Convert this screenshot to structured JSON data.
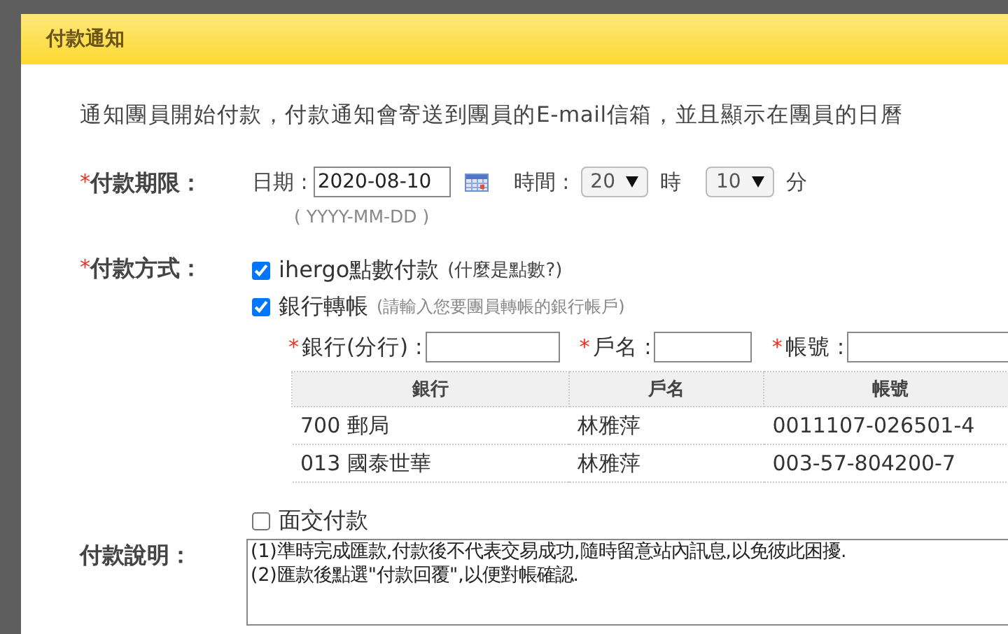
{
  "dialog": {
    "title": "付款通知",
    "description": "通知團員開始付款，付款通知會寄送到團員的E-mail信箱，並且顯示在團員的日曆",
    "deadline": {
      "mark": "*",
      "label": "付款期限：",
      "date_label": "日期 :",
      "date": "2020-08-10",
      "date_format": "( YYYY-MM-DD )",
      "time_label": "時間 :",
      "hour": "20",
      "hour_unit": "時",
      "minute": "10",
      "minute_unit": "分"
    },
    "payment_methods": {
      "mark": "*",
      "label": "付款方式：",
      "options": [
        {
          "kind": "plain",
          "label": "ihergo點數付款",
          "note": "(什麼是點數?)",
          "checked": true
        },
        {
          "kind": "bank",
          "label": "銀行轉帳",
          "note": "(請輸入您要團員轉帳的銀行帳戶)",
          "checked": true,
          "fields": [
            {
              "mark": "*",
              "label": "銀行(分行) :"
            },
            {
              "mark": "*",
              "label": "戶名 :"
            },
            {
              "mark": "*",
              "label": "帳號 :"
            }
          ],
          "table": {
            "columns": [
              "銀行",
              "戶名",
              "帳號"
            ],
            "rows": [
              [
                "700 郵局",
                "林雅萍",
                "0011107-026501-4"
              ],
              [
                "013 國泰世華",
                "林雅萍",
                "003-57-804200-7"
              ]
            ]
          }
        },
        {
          "kind": "plain",
          "label": "面交付款",
          "checked": false
        }
      ]
    },
    "instructions": {
      "label": "付款說明：",
      "text": "(1)準時完成匯款,付款後不代表交易成功,隨時留意站內訊息,以免彼此困擾.\n(2)匯款後點選\"付款回覆\",以便對帳確認."
    }
  }
}
